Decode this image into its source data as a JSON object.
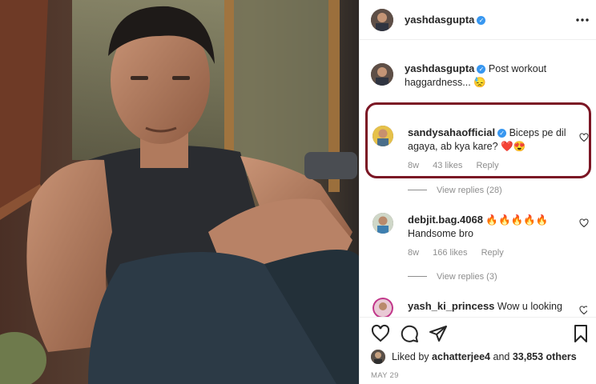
{
  "post": {
    "username": "yashdasgupta",
    "more_icon": "more-horizontal-icon",
    "caption": {
      "username": "yashdasgupta",
      "text": "Post workout haggardness... 😓"
    },
    "comments": [
      {
        "username": "sandysahaofficial",
        "verified": true,
        "text": "Biceps pe dil agaya, ab kya kare? ❤️😍",
        "time": "8w",
        "likes": "43 likes",
        "reply_label": "Reply",
        "view_replies": "View replies (28)"
      },
      {
        "username": "debjit.bag.4068",
        "verified": false,
        "text": "🔥🔥🔥🔥🔥 Handsome bro",
        "time": "8w",
        "likes": "166 likes",
        "reply_label": "Reply",
        "view_replies": "View replies (3)"
      },
      {
        "username": "yash_ki_princess",
        "verified": false,
        "text": "Wow u looking"
      }
    ],
    "liked_by": {
      "prefix": "Liked by",
      "user": "achatterjee4",
      "connector": "and",
      "others": "33,853 others"
    },
    "date": "MAY 29"
  },
  "colors": {
    "highlight": "#7b1624",
    "verified": "#3897f0",
    "meta": "#8e8e8e"
  }
}
